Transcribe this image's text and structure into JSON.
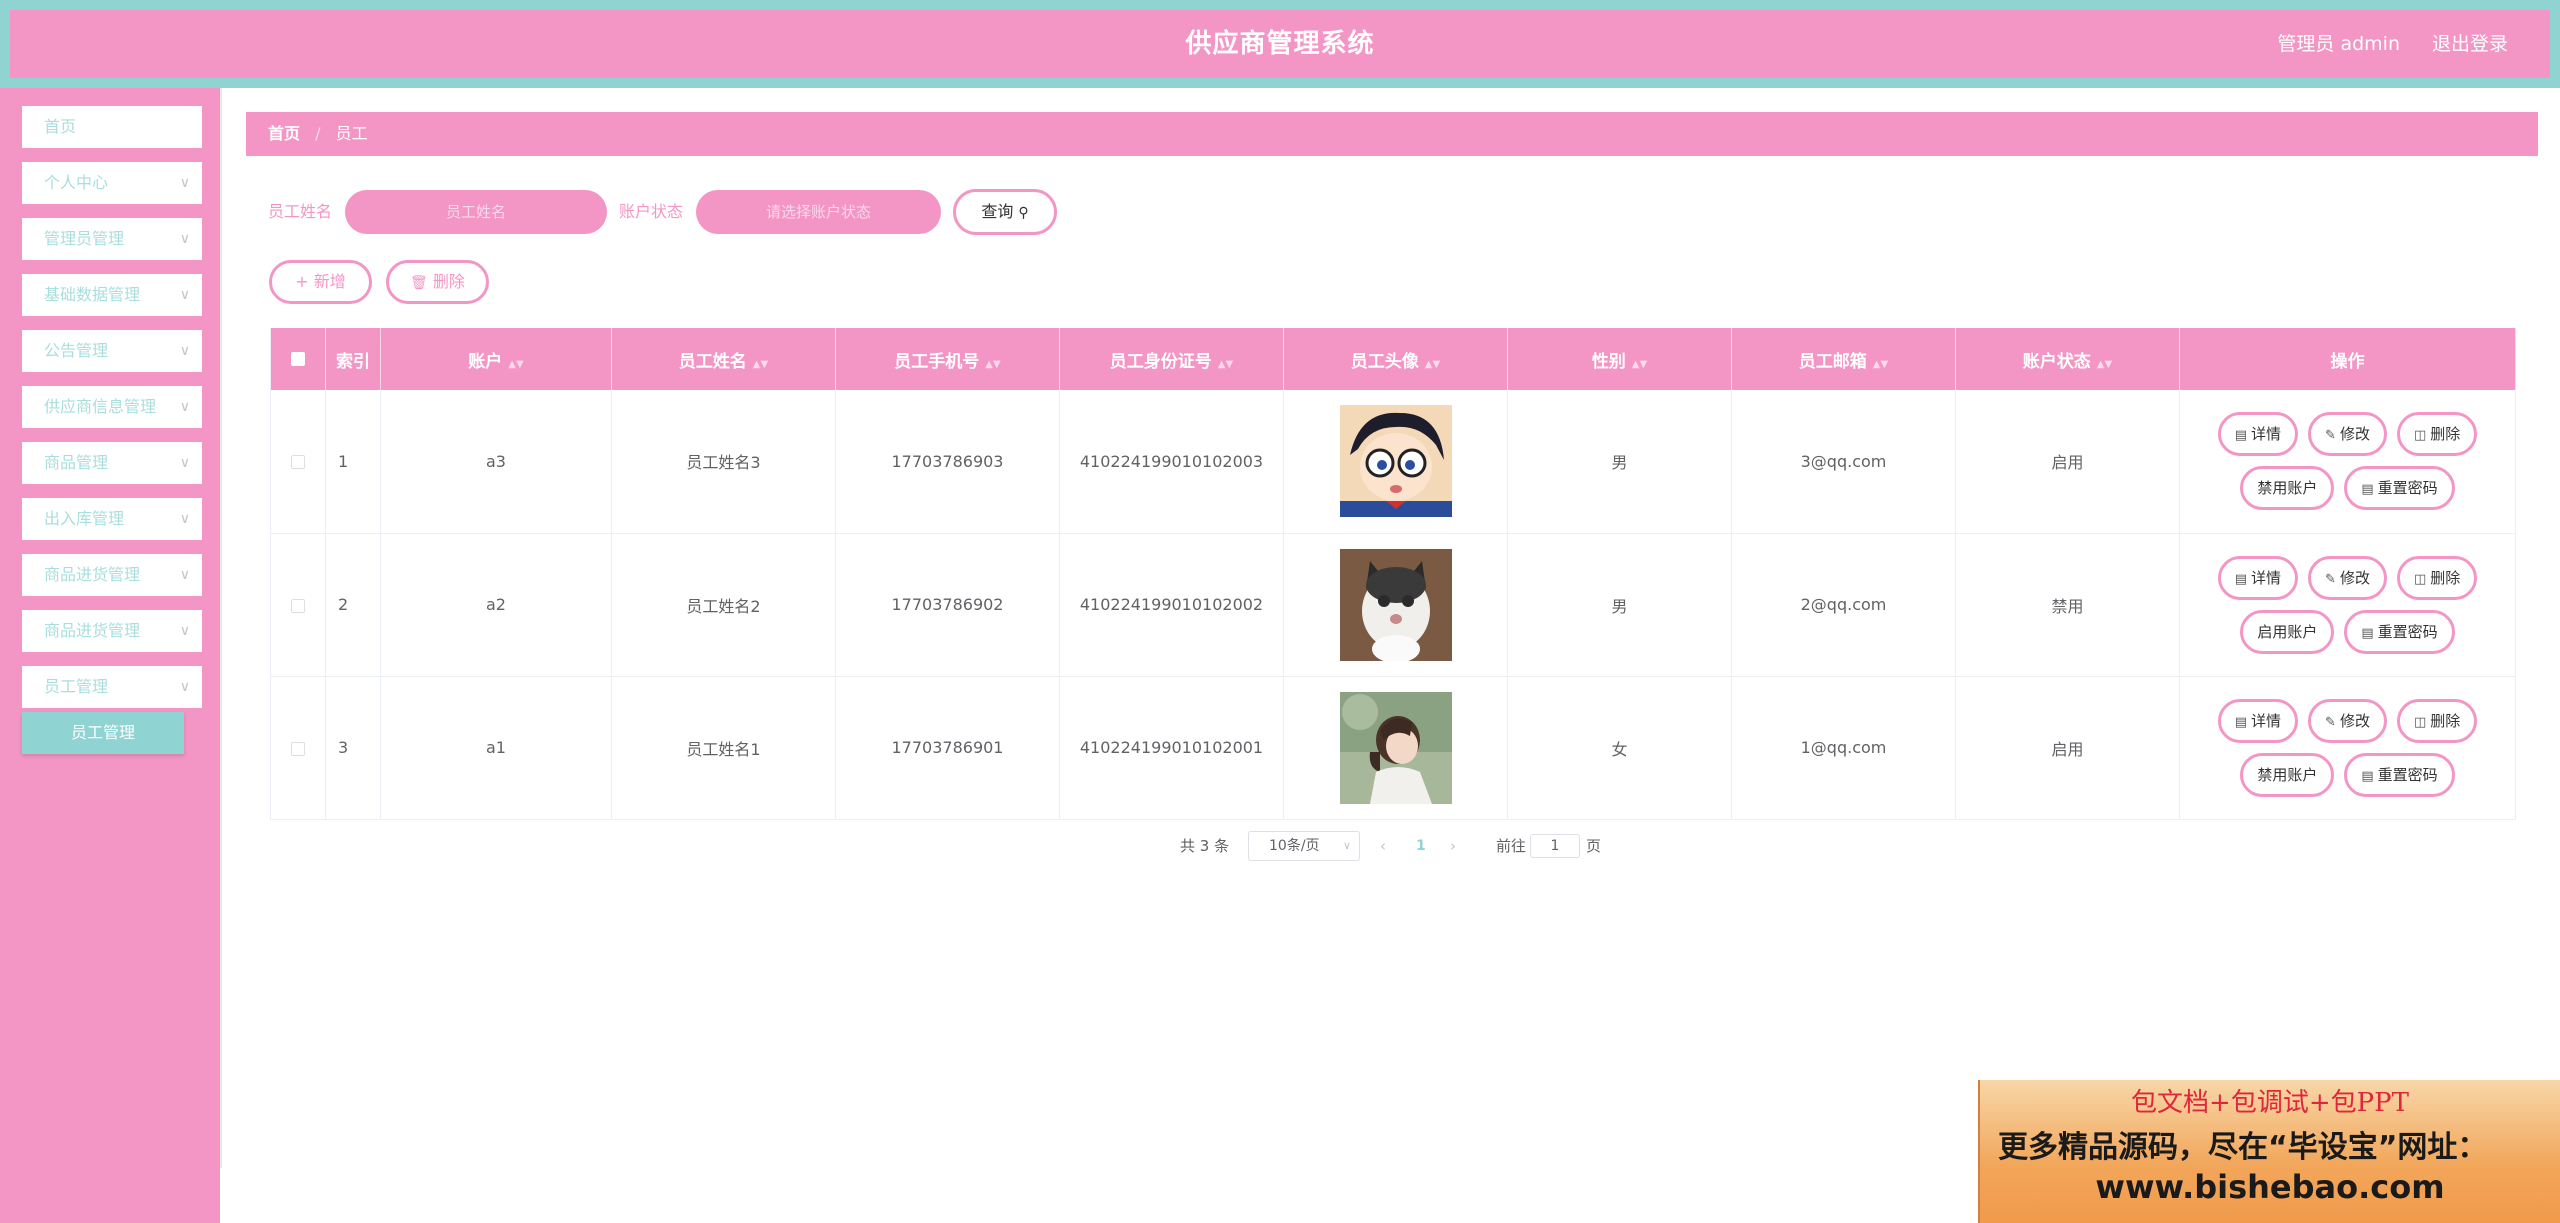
{
  "header": {
    "title": "供应商管理系统",
    "user": "管理员 admin",
    "logout": "退出登录"
  },
  "sidebar": {
    "items": [
      {
        "label": "首页",
        "has_children": false
      },
      {
        "label": "个人中心",
        "has_children": true
      },
      {
        "label": "管理员管理",
        "has_children": true
      },
      {
        "label": "基础数据管理",
        "has_children": true
      },
      {
        "label": "公告管理",
        "has_children": true
      },
      {
        "label": "供应商信息管理",
        "has_children": true
      },
      {
        "label": "商品管理",
        "has_children": true
      },
      {
        "label": "出入库管理",
        "has_children": true
      },
      {
        "label": "商品进货管理",
        "has_children": true
      },
      {
        "label": "商品进货管理",
        "has_children": true
      },
      {
        "label": "员工管理",
        "has_children": true
      }
    ],
    "active_submenu": "员工管理"
  },
  "breadcrumb": {
    "home": "首页",
    "separator": "/",
    "current": "员工"
  },
  "search": {
    "name_label": "员工姓名",
    "name_placeholder": "员工姓名",
    "status_label": "账户状态",
    "status_placeholder": "请选择账户状态",
    "query_button": "查询"
  },
  "actions": {
    "add": "新增",
    "delete": "删除"
  },
  "table": {
    "columns": [
      "索引",
      "账户",
      "员工姓名",
      "员工手机号",
      "员工身份证号",
      "员工头像",
      "性别",
      "员工邮箱",
      "账户状态",
      "操作"
    ],
    "rows": [
      {
        "index": "1",
        "account": "a3",
        "name": "员工姓名3",
        "phone": "17703786903",
        "id_card": "410224199010102003",
        "avatar": "cartoon-boy-glasses",
        "gender": "男",
        "email": "3@qq.com",
        "status": "启用",
        "toggle_label": "禁用账户"
      },
      {
        "index": "2",
        "account": "a2",
        "name": "员工姓名2",
        "phone": "17703786902",
        "id_card": "410224199010102002",
        "avatar": "cat-photo",
        "gender": "男",
        "email": "2@qq.com",
        "status": "禁用",
        "toggle_label": "启用账户"
      },
      {
        "index": "3",
        "account": "a1",
        "name": "员工姓名1",
        "phone": "17703786901",
        "id_card": "410224199010102001",
        "avatar": "girl-photo",
        "gender": "女",
        "email": "1@qq.com",
        "status": "启用",
        "toggle_label": "禁用账户"
      }
    ],
    "row_actions": {
      "detail": "详情",
      "edit": "修改",
      "delete": "删除",
      "reset_password": "重置密码"
    }
  },
  "pagination": {
    "total": "共 3 条",
    "page_size": "10条/页",
    "current_page": "1",
    "goto_label": "前往",
    "goto_value": "1",
    "page_word": "页"
  },
  "banner": {
    "line1": "包文档+包调试+包PPT",
    "line2": "更多精品源码，尽在“毕设宝”网址：",
    "line3": "www.bishebao.com"
  },
  "colors": {
    "primary_pink": "#f396c6",
    "accent_teal": "#8fd3d3"
  }
}
